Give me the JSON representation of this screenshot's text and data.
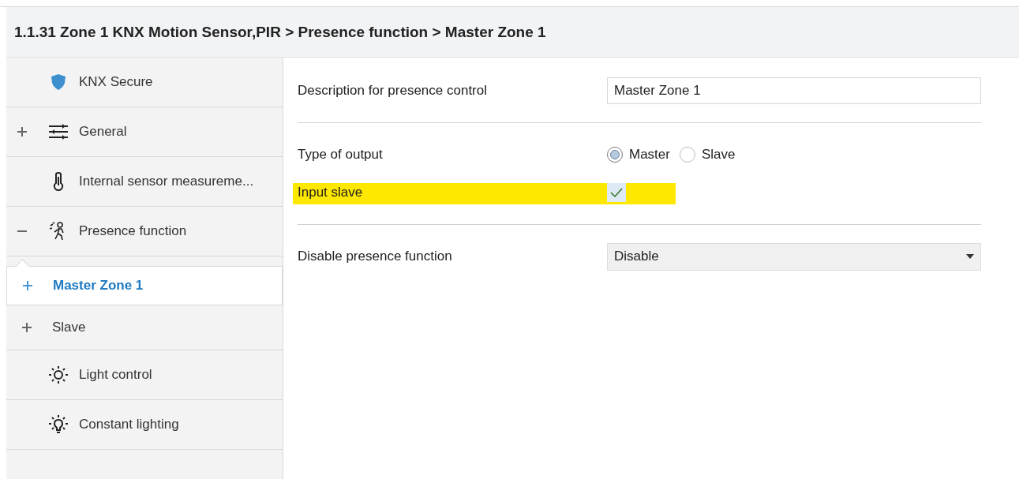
{
  "breadcrumb": {
    "parts": [
      "1.1.31 Zone 1 KNX Motion Sensor,PIR",
      "Presence function",
      "Master Zone 1"
    ],
    "separator": ">"
  },
  "sidebar": {
    "items": [
      {
        "label": "KNX Secure",
        "kind": "leaf",
        "selected": false
      },
      {
        "label": "General",
        "kind": "node",
        "expanded": false,
        "selected": false
      },
      {
        "label": "Internal sensor measureme...",
        "kind": "leaf",
        "selected": false
      },
      {
        "label": "Presence function",
        "kind": "node",
        "expanded": true,
        "selected": false,
        "children": [
          {
            "label": "Master Zone 1",
            "kind": "node",
            "expanded": false,
            "selected": true
          },
          {
            "label": "Slave",
            "kind": "node",
            "expanded": false,
            "selected": false
          }
        ]
      },
      {
        "label": "Light control",
        "kind": "leaf",
        "selected": false
      },
      {
        "label": "Constant lighting",
        "kind": "leaf",
        "selected": false
      }
    ]
  },
  "settings": [
    {
      "kind": "text",
      "label": "Description for presence control",
      "value": "Master Zone 1",
      "highlighted": false
    },
    {
      "kind": "divider"
    },
    {
      "kind": "radio",
      "label": "Type of output",
      "highlighted": false,
      "options": [
        {
          "label": "Master",
          "selected": true
        },
        {
          "label": "Slave",
          "selected": false
        }
      ]
    },
    {
      "kind": "checkbox",
      "label": "Input slave",
      "checked": true,
      "highlighted": true
    },
    {
      "kind": "divider"
    },
    {
      "kind": "dropdown",
      "label": "Disable presence function",
      "value": "Disable",
      "highlighted": false
    }
  ]
}
